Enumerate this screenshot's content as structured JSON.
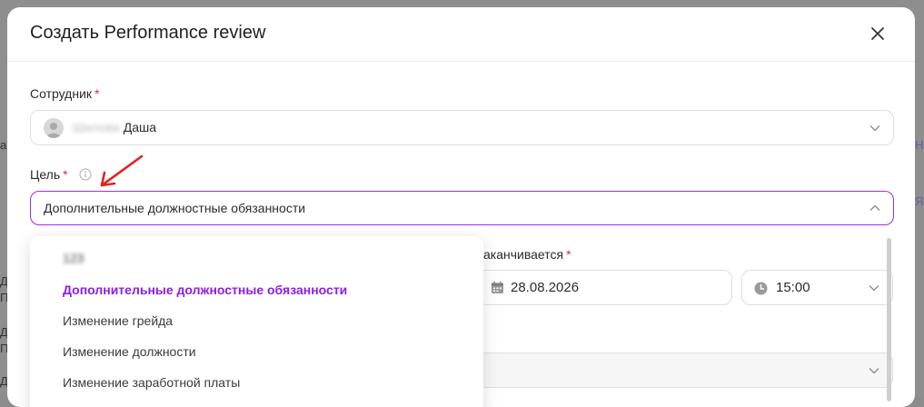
{
  "modal": {
    "title": "Создать Performance review",
    "close_icon": "close-icon"
  },
  "employee": {
    "label": "Сотрудник",
    "required_mark": "*",
    "value_blurred": "Шилова",
    "value_name": "Даша"
  },
  "goal": {
    "label": "Цель",
    "required_mark": "*",
    "info_icon": "info-icon",
    "value": "Дополнительные должностные обязанности"
  },
  "ends": {
    "label": "аканчивается",
    "required_mark": "*",
    "date": "28.08.2026",
    "time": "15:00"
  },
  "dropdown": {
    "first_blurred": "123",
    "items": [
      "Дополнительные должностные обязанности",
      "Изменение грейда",
      "Изменение должности",
      "Изменение заработной платы"
    ],
    "selected_index": 0
  },
  "background": {
    "left_fragments": [
      "а",
      "Д",
      "П",
      "Д",
      "П",
      "Д"
    ],
    "right_fragments": [
      "Н",
      "Я"
    ]
  },
  "colors": {
    "accent": "#8a1ee6",
    "focus_border": "#9c2ee0",
    "required": "#e2244a",
    "annotation_arrow": "#e0231c"
  }
}
